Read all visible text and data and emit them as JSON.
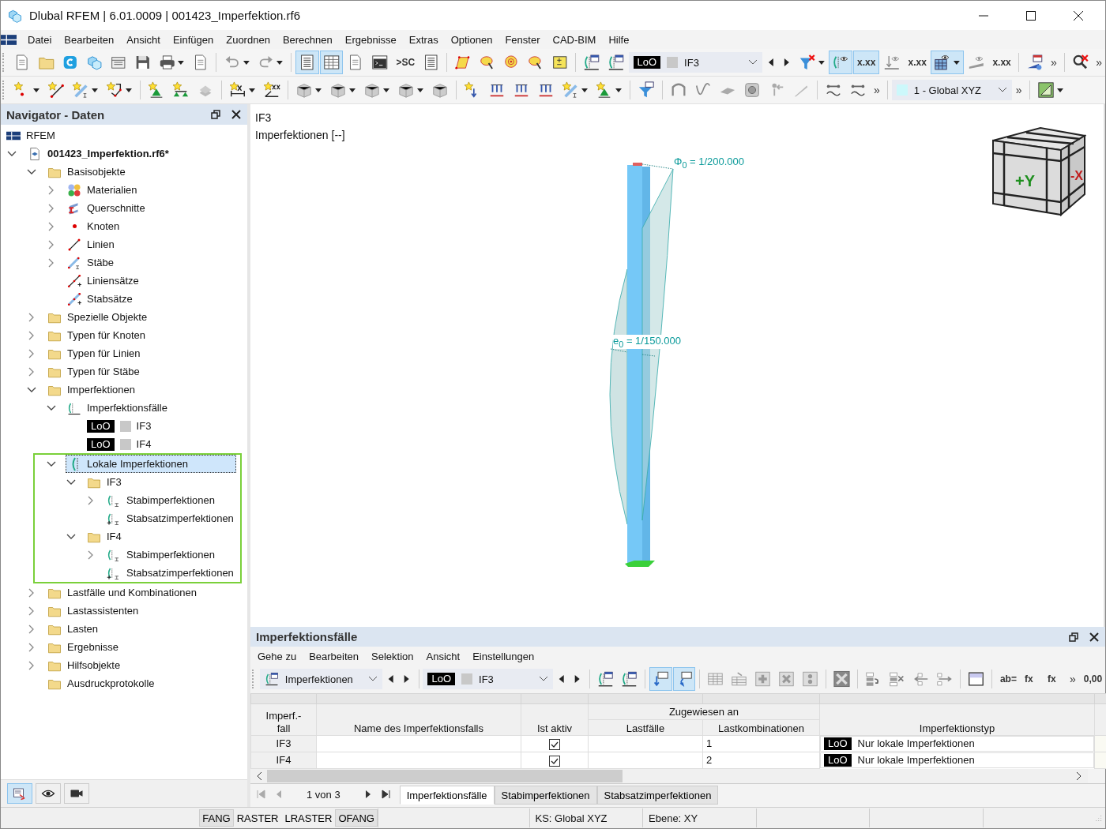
{
  "window": {
    "title": "Dlubal RFEM | 6.01.0009 | 001423_Imperfektion.rf6"
  },
  "menu": [
    "Datei",
    "Bearbeiten",
    "Ansicht",
    "Einfügen",
    "Zuordnen",
    "Berechnen",
    "Ergebnisse",
    "Extras",
    "Optionen",
    "Fenster",
    "CAD-BIM",
    "Hilfe"
  ],
  "toolbars": [
    {
      "items": [
        {
          "kind": "button",
          "pressed": false
        },
        {
          "kind": "button",
          "pressed": false
        },
        {
          "kind": "button",
          "pressed": false
        },
        {
          "kind": "button",
          "pressed": false
        },
        {
          "kind": "button",
          "pressed": false
        },
        {
          "kind": "button",
          "pressed": false
        },
        {
          "kind": "dropdown",
          "pressed": false
        },
        {
          "kind": "button",
          "pressed": false
        },
        {
          "kind": "separator"
        },
        {
          "kind": "dropdown",
          "pressed": false
        },
        {
          "kind": "dropdown",
          "pressed": false
        },
        {
          "kind": "separator"
        },
        {
          "kind": "button",
          "pressed": true
        },
        {
          "kind": "button",
          "pressed": true
        },
        {
          "kind": "button",
          "pressed": false
        },
        {
          "kind": "button",
          "pressed": false
        },
        {
          "kind": "text-button",
          "text": ">SC",
          "pressed": false
        },
        {
          "kind": "button",
          "pressed": false
        },
        {
          "kind": "separator"
        },
        {
          "kind": "button",
          "pressed": false
        },
        {
          "kind": "button",
          "pressed": false
        },
        {
          "kind": "button",
          "pressed": false
        },
        {
          "kind": "button",
          "pressed": false
        },
        {
          "kind": "button",
          "pressed": false
        },
        {
          "kind": "separator"
        },
        {
          "kind": "button",
          "pressed": false
        },
        {
          "kind": "button",
          "pressed": false
        },
        {
          "kind": "case-combo",
          "badge": "LoO",
          "text": "IF3"
        },
        {
          "kind": "nav-prev"
        },
        {
          "kind": "nav-next"
        },
        {
          "kind": "dropdown",
          "pressed": false
        },
        {
          "kind": "button",
          "pressed": true
        },
        {
          "kind": "text-button",
          "text": "x.xx",
          "pressed": true
        },
        {
          "kind": "button",
          "pressed": false
        },
        {
          "kind": "text-button",
          "text": "x.xx",
          "pressed": false
        },
        {
          "kind": "dropdown",
          "pressed": true
        },
        {
          "kind": "button",
          "pressed": false
        },
        {
          "kind": "text-button",
          "text": "x.xx",
          "pressed": false
        },
        {
          "kind": "separator"
        },
        {
          "kind": "button",
          "pressed": false
        },
        {
          "kind": "overflow",
          "text": "»"
        },
        {
          "kind": "separator"
        },
        {
          "kind": "button",
          "pressed": false
        },
        {
          "kind": "overflow",
          "text": "»"
        }
      ]
    },
    {
      "items": [
        {
          "kind": "dropdown",
          "pressed": false
        },
        {
          "kind": "button",
          "pressed": false
        },
        {
          "kind": "dropdown",
          "pressed": false
        },
        {
          "kind": "dropdown",
          "pressed": false
        },
        {
          "kind": "separator"
        },
        {
          "kind": "button",
          "pressed": false
        },
        {
          "kind": "button",
          "pressed": false
        },
        {
          "kind": "button",
          "pressed": false
        },
        {
          "kind": "separator"
        },
        {
          "kind": "dropdown",
          "pressed": false
        },
        {
          "kind": "button",
          "pressed": false
        },
        {
          "kind": "separator"
        },
        {
          "kind": "dropdown",
          "pressed": false
        },
        {
          "kind": "dropdown",
          "pressed": false
        },
        {
          "kind": "dropdown",
          "pressed": false
        },
        {
          "kind": "dropdown",
          "pressed": false
        },
        {
          "kind": "button",
          "pressed": false
        },
        {
          "kind": "separator"
        },
        {
          "kind": "button",
          "pressed": false
        },
        {
          "kind": "button",
          "pressed": false
        },
        {
          "kind": "button",
          "pressed": false
        },
        {
          "kind": "button",
          "pressed": false
        },
        {
          "kind": "dropdown",
          "pressed": false
        },
        {
          "kind": "dropdown",
          "pressed": false
        },
        {
          "kind": "separator"
        },
        {
          "kind": "button",
          "pressed": false
        },
        {
          "kind": "separator"
        },
        {
          "kind": "button",
          "pressed": false
        },
        {
          "kind": "button",
          "pressed": false
        },
        {
          "kind": "button",
          "pressed": false
        },
        {
          "kind": "button",
          "pressed": false
        },
        {
          "kind": "button",
          "pressed": false
        },
        {
          "kind": "button",
          "pressed": false
        },
        {
          "kind": "separator"
        },
        {
          "kind": "button",
          "pressed": false
        },
        {
          "kind": "button",
          "pressed": false
        },
        {
          "kind": "overflow",
          "text": "»"
        },
        {
          "kind": "separator"
        },
        {
          "kind": "coord-combo",
          "text": "1 - Global XYZ"
        },
        {
          "kind": "overflow",
          "text": "»"
        },
        {
          "kind": "separator"
        },
        {
          "kind": "dropdown",
          "pressed": false
        }
      ]
    }
  ],
  "navigator": {
    "title": "Navigator - Daten",
    "tree": [
      {
        "kind": "rfem",
        "label": "RFEM",
        "selected": false
      },
      {
        "kind": "file",
        "label": "001423_Imperfektion.rf6*",
        "selected": false,
        "expanded": true,
        "children": [
          {
            "kind": "folder",
            "label": "Basisobjekte",
            "selected": false,
            "expanded": true,
            "children": [
              {
                "kind": "materials",
                "label": "Materialien",
                "selected": false,
                "expanded": false
              },
              {
                "kind": "sections",
                "label": "Querschnitte",
                "selected": false,
                "expanded": false
              },
              {
                "kind": "nodes",
                "label": "Knoten",
                "selected": false,
                "expanded": false
              },
              {
                "kind": "lines",
                "label": "Linien",
                "selected": false,
                "expanded": false
              },
              {
                "kind": "members",
                "label": "Stäbe",
                "selected": false,
                "expanded": false
              },
              {
                "kind": "line-sets",
                "label": "Liniensätze",
                "selected": false
              },
              {
                "kind": "member-sets",
                "label": "Stabsätze",
                "selected": false
              }
            ]
          },
          {
            "kind": "folder",
            "label": "Spezielle Objekte",
            "selected": false,
            "expanded": false
          },
          {
            "kind": "folder",
            "label": "Typen für Knoten",
            "selected": false,
            "expanded": false
          },
          {
            "kind": "folder",
            "label": "Typen für Linien",
            "selected": false,
            "expanded": false
          },
          {
            "kind": "folder",
            "label": "Typen für Stäbe",
            "selected": false,
            "expanded": false
          },
          {
            "kind": "folder",
            "label": "Imperfektionen",
            "selected": false,
            "expanded": true,
            "children": [
              {
                "kind": "imperfection-cases",
                "label": "Imperfektionsfälle",
                "selected": false,
                "expanded": true,
                "children": [
                  {
                    "kind": "case",
                    "badge": "LoO",
                    "label": "IF3",
                    "selected": false
                  },
                  {
                    "kind": "case",
                    "badge": "LoO",
                    "label": "IF4",
                    "selected": false
                  }
                ]
              },
              {
                "kind": "local-imperfections",
                "label": "Lokale Imperfektionen",
                "selected": true,
                "highlighted": true,
                "expanded": true,
                "children": [
                  {
                    "kind": "folder",
                    "label": "IF3",
                    "selected": false,
                    "expanded": true,
                    "children": [
                      {
                        "kind": "member-imperfections",
                        "label": "Stabimperfektionen",
                        "selected": false,
                        "expanded": false
                      },
                      {
                        "kind": "member-set-imperfections",
                        "label": "Stabsatzimperfektionen",
                        "selected": false
                      }
                    ]
                  },
                  {
                    "kind": "folder",
                    "label": "IF4",
                    "selected": false,
                    "expanded": true,
                    "children": [
                      {
                        "kind": "member-imperfections",
                        "label": "Stabimperfektionen",
                        "selected": false,
                        "expanded": false
                      },
                      {
                        "kind": "member-set-imperfections",
                        "label": "Stabsatzimperfektionen",
                        "selected": false
                      }
                    ]
                  }
                ]
              }
            ]
          },
          {
            "kind": "folder",
            "label": "Lastfälle und Kombinationen",
            "selected": false,
            "expanded": false
          },
          {
            "kind": "folder",
            "label": "Lastassistenten",
            "selected": false,
            "expanded": false
          },
          {
            "kind": "folder",
            "label": "Lasten",
            "selected": false,
            "expanded": false
          },
          {
            "kind": "folder",
            "label": "Ergebnisse",
            "selected": false,
            "expanded": false
          },
          {
            "kind": "folder",
            "label": "Hilfsobjekte",
            "selected": false,
            "expanded": false
          },
          {
            "kind": "folder",
            "label": "Ausdruckprotokolle",
            "selected": false
          }
        ]
      }
    ],
    "tabs": [
      {
        "selected": true
      },
      {
        "selected": false
      },
      {
        "selected": false
      }
    ]
  },
  "viewport": {
    "case": "IF3",
    "caption": "Imperfektionen [--]",
    "annotations": [
      {
        "kind": "sway",
        "text": "Φ$_{0}$ =  1/200.000"
      },
      {
        "kind": "bow",
        "text": "e$_{0}$ =  1/150.000"
      }
    ],
    "view_cube": {
      "front": "+Y",
      "side": "-X"
    }
  },
  "panel": {
    "title": "Imperfektionsfälle",
    "menu": [
      "Gehe zu",
      "Bearbeiten",
      "Selektion",
      "Ansicht",
      "Einstellungen"
    ],
    "toolbar": {
      "items": [
        {
          "kind": "combo",
          "text": "Imperfektionen"
        },
        {
          "kind": "nav-prev"
        },
        {
          "kind": "nav-next"
        },
        {
          "kind": "separator"
        },
        {
          "kind": "case-combo",
          "badge": "LoO",
          "text": "IF3"
        },
        {
          "kind": "nav-prev"
        },
        {
          "kind": "nav-next"
        },
        {
          "kind": "separator"
        },
        {
          "kind": "button",
          "pressed": false
        },
        {
          "kind": "button",
          "pressed": false
        },
        {
          "kind": "separator"
        },
        {
          "kind": "button",
          "pressed": true
        },
        {
          "kind": "button",
          "pressed": true
        },
        {
          "kind": "separator"
        },
        {
          "kind": "button",
          "pressed": false
        },
        {
          "kind": "button",
          "pressed": false
        },
        {
          "kind": "button",
          "pressed": false
        },
        {
          "kind": "button",
          "pressed": false
        },
        {
          "kind": "button",
          "pressed": false
        },
        {
          "kind": "separator"
        },
        {
          "kind": "button",
          "pressed": false
        },
        {
          "kind": "separator"
        },
        {
          "kind": "button",
          "pressed": false
        },
        {
          "kind": "button",
          "pressed": false
        },
        {
          "kind": "button",
          "pressed": false
        },
        {
          "kind": "button",
          "pressed": false
        },
        {
          "kind": "separator"
        },
        {
          "kind": "button",
          "pressed": false
        },
        {
          "kind": "separator"
        },
        {
          "kind": "text-button",
          "text": "ab=",
          "pressed": false
        },
        {
          "kind": "text-button",
          "text": "fx",
          "pressed": false
        },
        {
          "kind": "text-button",
          "text": "fx",
          "pressed": false
        },
        {
          "kind": "overflow",
          "text": "»"
        },
        {
          "kind": "text-button",
          "text": "0,00",
          "pressed": false
        }
      ]
    },
    "table": {
      "group_header": "Zugewiesen an",
      "columns": [
        "Imperf.-fall",
        "Name des Imperfektionsfalls",
        "Ist aktiv",
        "Lastfälle",
        "Lastkombinationen",
        "Imperfektionstyp"
      ],
      "rows": [
        {
          "case": "IF3",
          "active": true,
          "load_combinations": "1",
          "type_badge": "LoO",
          "type": "Nur lokale Imperfektionen"
        },
        {
          "case": "IF4",
          "active": true,
          "load_combinations": "2",
          "type_badge": "LoO",
          "type": "Nur lokale Imperfektionen"
        }
      ]
    },
    "pager": "1 von 3",
    "tabs": [
      {
        "label": "Imperfektionsfälle",
        "selected": true
      },
      {
        "label": "Stabimperfektionen",
        "selected": false
      },
      {
        "label": "Stabsatzimperfektionen",
        "selected": false
      }
    ]
  },
  "status_bar": {
    "toggles": [
      {
        "text": "FANG",
        "on": true
      },
      {
        "text": "RASTER",
        "on": false
      },
      {
        "text": "LRASTER",
        "on": false
      },
      {
        "text": "OFANG",
        "on": true
      }
    ],
    "fields": [
      "KS: Global XYZ",
      "Ebene: XY"
    ]
  }
}
